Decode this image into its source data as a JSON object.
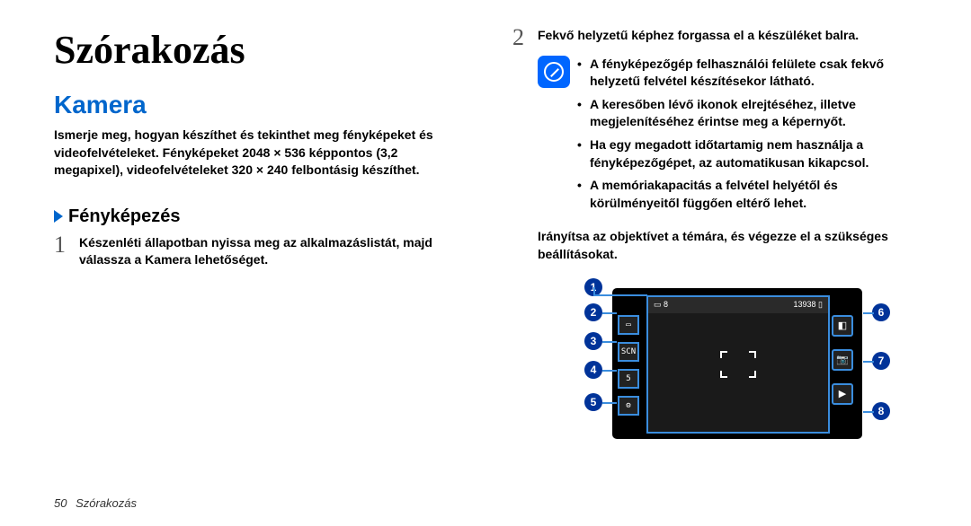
{
  "title": "Szórakozás",
  "section": "Kamera",
  "intro": "Ismerje meg, hogyan készíthet és tekinthet meg fényképeket és videofelvételeket. Fényképeket 2048 × 536 képpontos (3,2 megapixel), videofelvételeket 320 × 240 felbontásig készíthet.",
  "sub_heading": "Fényképezés",
  "step1_num": "1",
  "step1": "Készenléti állapotban nyissa meg az alkalmazáslistát, majd válassza a Kamera lehetőséget.",
  "step2_num": "2",
  "step2": "Fekvő helyzetű képhez forgassa el a készüléket balra.",
  "bullets": [
    "A fényképezőgép felhasználói felülete csak fekvő helyzetű felvétel készítésekor látható.",
    "A keresőben lévő ikonok elrejtéséhez, illetve megjelenítéséhez érintse meg a képernyőt.",
    "Ha egy megadott időtartamig nem használja a fényképezőgépet, az automatikusan kikapcsol.",
    "A memóriakapacitás a felvétel helyétől és körülményeitől függően eltérő lehet."
  ],
  "direction": "Irányítsa az objektívet a témára, és végezze el a szükséges beállításokat.",
  "camera": {
    "topbar_left": "▭ 8",
    "topbar_right": "13938 ▯",
    "left_icons": [
      "▭",
      "SCN",
      "5",
      "⚙"
    ],
    "right_icons": [
      "◧",
      "📷",
      "▶"
    ]
  },
  "callouts": {
    "c1": "1",
    "c2": "2",
    "c3": "3",
    "c4": "4",
    "c5": "5",
    "c6": "6",
    "c7": "7",
    "c8": "8"
  },
  "footer_page": "50",
  "footer_text": "Szórakozás"
}
